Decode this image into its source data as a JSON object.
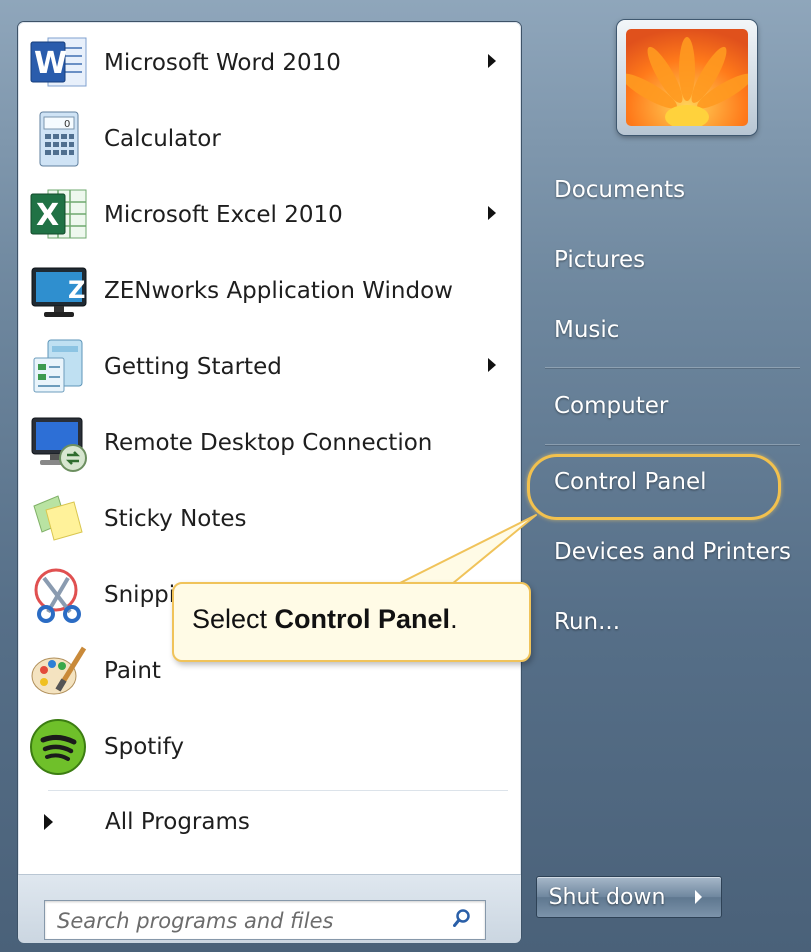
{
  "programs": [
    {
      "label": "Microsoft Word 2010",
      "icon": "word-icon",
      "has_submenu": true
    },
    {
      "label": "Calculator",
      "icon": "calculator-icon",
      "has_submenu": false
    },
    {
      "label": "Microsoft Excel 2010",
      "icon": "excel-icon",
      "has_submenu": true
    },
    {
      "label": "ZENworks Application Window",
      "icon": "zenworks-icon",
      "has_submenu": false
    },
    {
      "label": "Getting Started",
      "icon": "getting-started-icon",
      "has_submenu": true
    },
    {
      "label": "Remote Desktop Connection",
      "icon": "remote-desktop-icon",
      "has_submenu": false
    },
    {
      "label": "Sticky Notes",
      "icon": "sticky-notes-icon",
      "has_submenu": false
    },
    {
      "label": "Snipping Tool",
      "icon": "snipping-tool-icon",
      "has_submenu": false
    },
    {
      "label": "Paint",
      "icon": "paint-icon",
      "has_submenu": false
    },
    {
      "label": "Spotify",
      "icon": "spotify-icon",
      "has_submenu": false
    }
  ],
  "all_programs_label": "All Programs",
  "search": {
    "placeholder": "Search programs and files"
  },
  "right_pane": {
    "items": [
      "Documents",
      "Pictures",
      "Music",
      "Computer",
      "Control Panel",
      "Devices and Printers",
      "Run..."
    ]
  },
  "callout": {
    "prefix": "Select ",
    "bold": "Control Panel",
    "suffix": "."
  },
  "shutdown": {
    "label": "Shut down"
  },
  "colors": {
    "highlight": "#f2c14e",
    "callout_bg": "#fffbe6",
    "pane_bg": "#ffffff"
  }
}
